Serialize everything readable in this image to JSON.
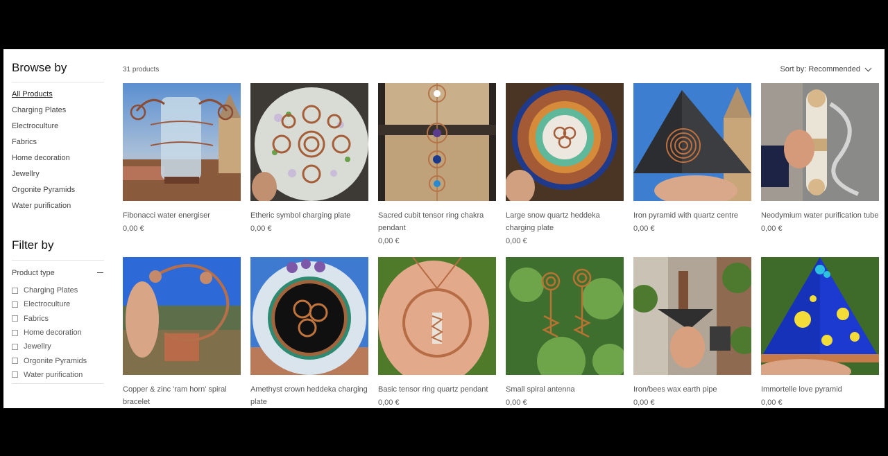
{
  "sidebar": {
    "browse_title": "Browse by",
    "categories": [
      "All Products",
      "Charging Plates",
      "Electroculture",
      "Fabrics",
      "Home decoration",
      "Jewellry",
      "Orgonite Pyramids",
      "Water purification"
    ],
    "filter_title": "Filter by",
    "product_type_label": "Product type",
    "product_types": [
      "Charging Plates",
      "Electroculture",
      "Fabrics",
      "Home decoration",
      "Jewellry",
      "Orgonite Pyramids",
      "Water purification"
    ]
  },
  "main": {
    "count": "31 products",
    "sort_label": "Sort by: Recommended"
  },
  "products": [
    {
      "name": "Fibonacci water energiser",
      "price": "0,00 €",
      "image": "spiral-jar-photo"
    },
    {
      "name": "Etheric symbol charging plate",
      "price": "0,00 €",
      "image": "copper-spiral-plate-photo"
    },
    {
      "name": "Sacred cubit tensor ring chakra pendant",
      "price": "0,00 €",
      "image": "chakra-pendant-photo"
    },
    {
      "name": "Large snow quartz heddeka charging plate",
      "price": "0,00 €",
      "image": "quartz-plate-photo"
    },
    {
      "name": "Iron pyramid with quartz centre",
      "price": "0,00 €",
      "image": "iron-pyramid-photo"
    },
    {
      "name": "Neodymium water purification tube",
      "price": "0,00 €",
      "image": "water-tube-photo"
    },
    {
      "name": "Copper & zinc 'ram horn' spiral bracelet",
      "price": "",
      "image": "bracelet-photo"
    },
    {
      "name": "Amethyst crown heddeka charging plate",
      "price": "",
      "image": "amethyst-plate-photo"
    },
    {
      "name": "Basic tensor ring quartz pendant",
      "price": "0,00 €",
      "image": "quartz-pendant-photo"
    },
    {
      "name": "Small spiral antenna",
      "price": "0,00 €",
      "image": "spiral-antenna-photo"
    },
    {
      "name": "Iron/bees wax earth pipe",
      "price": "0,00 €",
      "image": "earth-pipe-photo"
    },
    {
      "name": "Immortelle love pyramid",
      "price": "0,00 €",
      "image": "love-pyramid-photo"
    }
  ],
  "colors": {
    "accent": "#b87333",
    "text": "#555555",
    "background": "#ffffff",
    "frame": "#000000"
  }
}
